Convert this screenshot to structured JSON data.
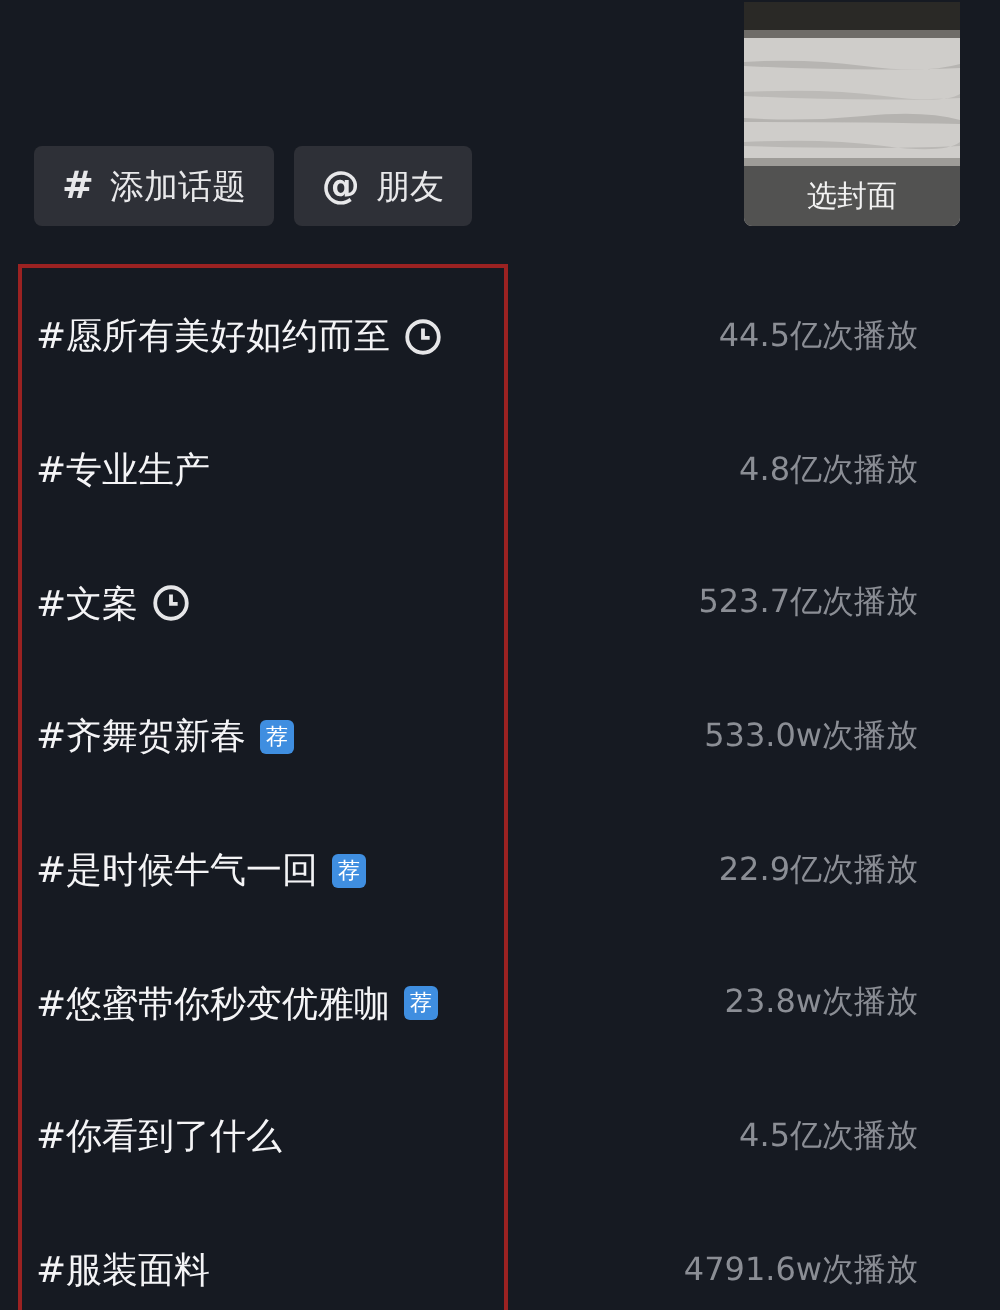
{
  "actions": [
    {
      "icon": "#",
      "label": "添加话题"
    },
    {
      "icon": "@",
      "label": "朋友"
    }
  ],
  "cover": {
    "kind": "picture",
    "label": "选封面"
  },
  "topics": [
    {
      "title": "#愿所有美好如约而至",
      "mark": {
        "kind": "clock"
      },
      "plays": "44.5亿次播放"
    },
    {
      "title": "#专业生产",
      "plays": "4.8亿次播放"
    },
    {
      "title": "#文案",
      "mark": {
        "kind": "clock"
      },
      "plays": "523.7亿次播放"
    },
    {
      "title": "#齐舞贺新春",
      "mark": {
        "kind": "badge",
        "text": "荐"
      },
      "plays": "533.0w次播放"
    },
    {
      "title": "#是时候牛气一回",
      "mark": {
        "kind": "badge",
        "text": "荐"
      },
      "plays": "22.9亿次播放"
    },
    {
      "title": "#悠蜜带你秒变优雅咖",
      "mark": {
        "kind": "badge",
        "text": "荐"
      },
      "plays": "23.8w次播放"
    },
    {
      "title": "#你看到了什么",
      "plays": "4.5亿次播放"
    },
    {
      "title": "#服装面料",
      "plays": "4791.6w次播放"
    }
  ]
}
